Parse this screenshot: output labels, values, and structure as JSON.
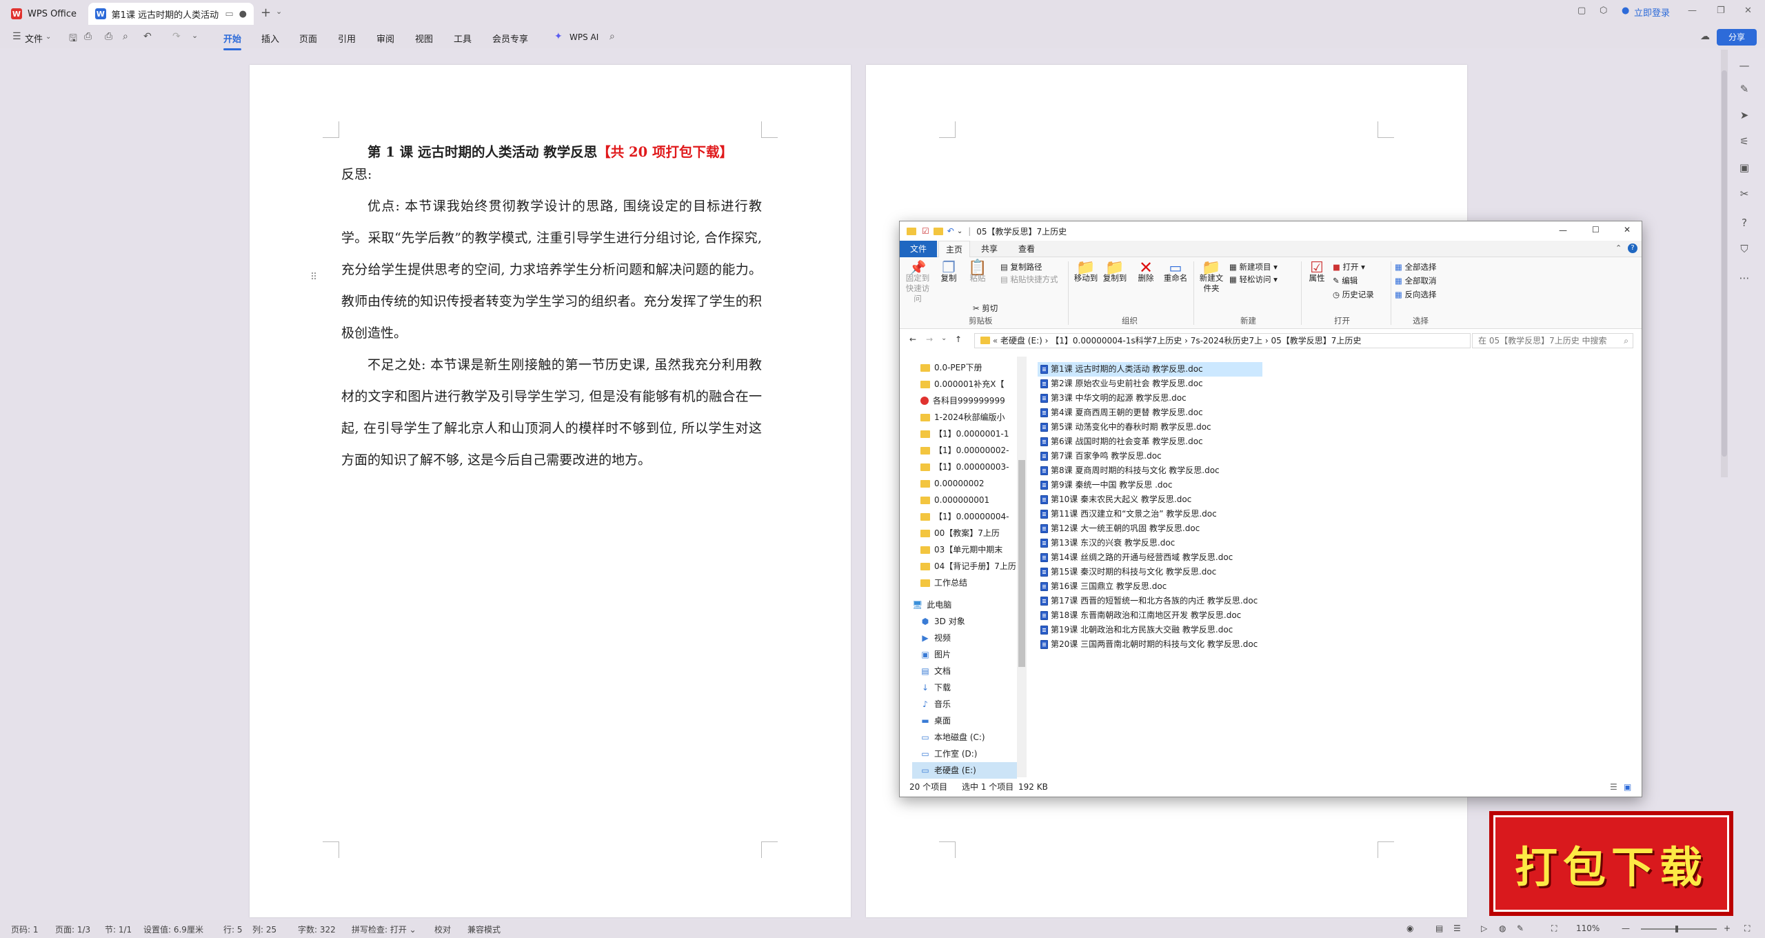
{
  "titlebar": {
    "home_tab": "WPS Office",
    "doc_tab": "第1课 远古时期的人类活动 教",
    "login": "立即登录"
  },
  "ribbon": {
    "file_menu": "文件",
    "menus": [
      "开始",
      "插入",
      "页面",
      "引用",
      "审阅",
      "视图",
      "工具",
      "会员专享"
    ],
    "ai": "WPS AI",
    "share": "分享"
  },
  "document": {
    "title_main": "第 1 课 远古时期的人类活动 教学反思",
    "title_red": "【共 20 项打包下载】",
    "heading": "反思:",
    "para1": "优点: 本节课我始终贯彻教学设计的思路, 围绕设定的目标进行教学。采取“先学后教”的教学模式, 注重引导学生进行分组讨论, 合作探究, 充分给学生提供思考的空间, 力求培养学生分析问题和解决问题的能力。教师由传统的知识传授者转变为学生学习的组织者。充分发挥了学生的积极创造性。",
    "para2": "不足之处: 本节课是新生刚接触的第一节历史课, 虽然我充分利用教材的文字和图片进行教学及引导学生学习, 但是没有能够有机的融合在一起, 在引导学生了解北京人和山顶洞人的模样时不够到位, 所以学生对这方面的知识了解不够, 这是今后自己需要改进的地方。"
  },
  "explorer": {
    "title": "05【教学反思】7上历史",
    "tabs": [
      "文件",
      "主页",
      "共享",
      "查看"
    ],
    "ribbon": {
      "pin": "固定到快速访问",
      "copy": "复制",
      "paste": "粘贴",
      "copy_path": "复制路径",
      "paste_shortcut": "粘贴快捷方式",
      "cut": "剪切",
      "clipboard": "剪贴板",
      "move_to": "移动到",
      "copy_to": "复制到",
      "delete": "删除",
      "rename": "重命名",
      "organize": "组织",
      "new_folder": "新建文件夹",
      "new_item": "新建项目",
      "easy_access": "轻松访问",
      "new_group": "新建",
      "properties": "属性",
      "open": "打开",
      "edit": "编辑",
      "history": "历史记录",
      "open_group": "打开",
      "select_all": "全部选择",
      "select_none": "全部取消",
      "invert": "反向选择",
      "select_group": "选择"
    },
    "address": [
      "老硬盘 (E:)",
      "【1】0.00000004-1s科学7上历史",
      "7s-2024秋历史7上",
      "05【教学反思】7上历史"
    ],
    "search_placeholder": "在 05【教学反思】7上历史 中搜索",
    "nav_items": [
      "0.0-PEP下册",
      "0.000001补充X【",
      "各科目999999999",
      "1-2024秋部编版小",
      "【1】0.0000001-1",
      "【1】0.00000002-",
      "【1】0.00000003-",
      "0.00000002",
      "0.000000001",
      "【1】0.00000004-",
      "00【教案】7上历",
      "03【单元期中期末",
      "04【背记手册】7上历",
      "工作总结"
    ],
    "pc": "此电脑",
    "pc_items": [
      "3D 对象",
      "视频",
      "图片",
      "文档",
      "下载",
      "音乐",
      "桌面",
      "本地磁盘 (C:)",
      "工作室 (D:)",
      "老硬盘 (E:)"
    ],
    "files": [
      "第1课 远古时期的人类活动 教学反思.doc",
      "第2课 原始农业与史前社会 教学反思.doc",
      "第3课 中华文明的起源 教学反思.doc",
      "第4课 夏商西周王朝的更替 教学反思.doc",
      "第5课 动荡变化中的春秋时期 教学反思.doc",
      "第6课 战国时期的社会变革 教学反思.doc",
      "第7课 百家争鸣 教学反思.doc",
      "第8课 夏商周时期的科技与文化 教学反思.doc",
      "第9课 秦统一中国 教学反思 .doc",
      "第10课 秦末农民大起义 教学反思.doc",
      "第11课 西汉建立和“文景之治” 教学反思.doc",
      "第12课 大一统王朝的巩固 教学反思.doc",
      "第13课 东汉的兴衰 教学反思.doc",
      "第14课 丝绸之路的开通与经营西域 教学反思.doc",
      "第15课 秦汉时期的科技与文化 教学反思.doc",
      "第16课 三国鼎立 教学反思.doc",
      "第17课 西晋的短暂统一和北方各族的内迁 教学反思.doc",
      "第18课 东晋南朝政治和江南地区开发 教学反思.doc",
      "第19课 北朝政治和北方民族大交融 教学反思.doc",
      "第20课 三国两晋南北朝时期的科技与文化 教学反思.doc"
    ],
    "status_count": "20 个项目",
    "status_selected": "选中 1 个项目",
    "status_size": "192 KB"
  },
  "statusbar": {
    "page": "页码: 1",
    "pages": "页面: 1/3",
    "section": "节: 1/1",
    "setting": "设置值: 6.9厘米",
    "row": "行: 5",
    "col": "列: 25",
    "words": "字数: 322",
    "spell": "拼写检查: 打开",
    "proof": "校对",
    "compat": "兼容模式",
    "zoom": "110%"
  },
  "stamp": "打包下载",
  "colors": {
    "accent": "#2d6bd9",
    "red": "#e0191b",
    "folder": "#f3c53f"
  }
}
